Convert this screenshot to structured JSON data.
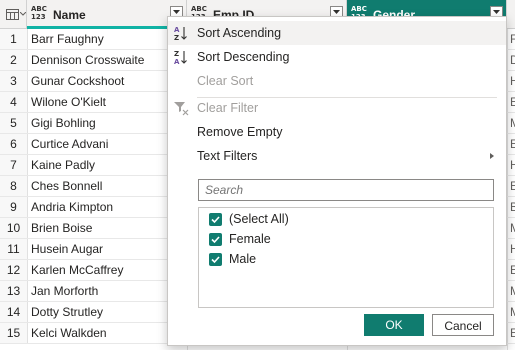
{
  "columns": {
    "row_num_header_icon": "table-icon",
    "name": {
      "type": "ABC\n123",
      "title": "Name"
    },
    "emp_id": {
      "type": "ABC\n123",
      "title": "Emp ID"
    },
    "gender": {
      "type": "ABC\n123",
      "title": "Gender"
    }
  },
  "rows": [
    {
      "n": "1",
      "name": "Barr Faughny",
      "g": "F"
    },
    {
      "n": "2",
      "name": "Dennison Crosswaite",
      "g": "D"
    },
    {
      "n": "3",
      "name": "Gunar Cockshoot",
      "g": "H"
    },
    {
      "n": "4",
      "name": "Wilone O'Kielt",
      "g": "E"
    },
    {
      "n": "5",
      "name": "Gigi Bohling",
      "g": "M"
    },
    {
      "n": "6",
      "name": "Curtice Advani",
      "g": "E"
    },
    {
      "n": "7",
      "name": "Kaine Padly",
      "g": "H"
    },
    {
      "n": "8",
      "name": "Ches Bonnell",
      "g": "E"
    },
    {
      "n": "9",
      "name": "Andria Kimpton",
      "g": "B"
    },
    {
      "n": "10",
      "name": "Brien Boise",
      "g": "M"
    },
    {
      "n": "11",
      "name": "Husein Augar",
      "g": "H"
    },
    {
      "n": "12",
      "name": "Karlen McCaffrey",
      "g": "E"
    },
    {
      "n": "13",
      "name": "Jan Morforth",
      "g": "M"
    },
    {
      "n": "14",
      "name": "Dotty Strutley",
      "g": "M"
    },
    {
      "n": "15",
      "name": "Kelci Walkden",
      "g": "E"
    }
  ],
  "menu": {
    "sort_ascending": "Sort Ascending",
    "sort_descending": "Sort Descending",
    "clear_sort": "Clear Sort",
    "clear_filter": "Clear Filter",
    "remove_empty": "Remove Empty",
    "text_filters": "Text Filters",
    "search_placeholder": "Search",
    "values": [
      {
        "label": "(Select All)",
        "checked": true
      },
      {
        "label": "Female",
        "checked": true
      },
      {
        "label": "Male",
        "checked": true
      }
    ],
    "ok": "OK",
    "cancel": "Cancel"
  },
  "colors": {
    "accent": "#107c6f",
    "accent_line": "#11b3a5"
  }
}
